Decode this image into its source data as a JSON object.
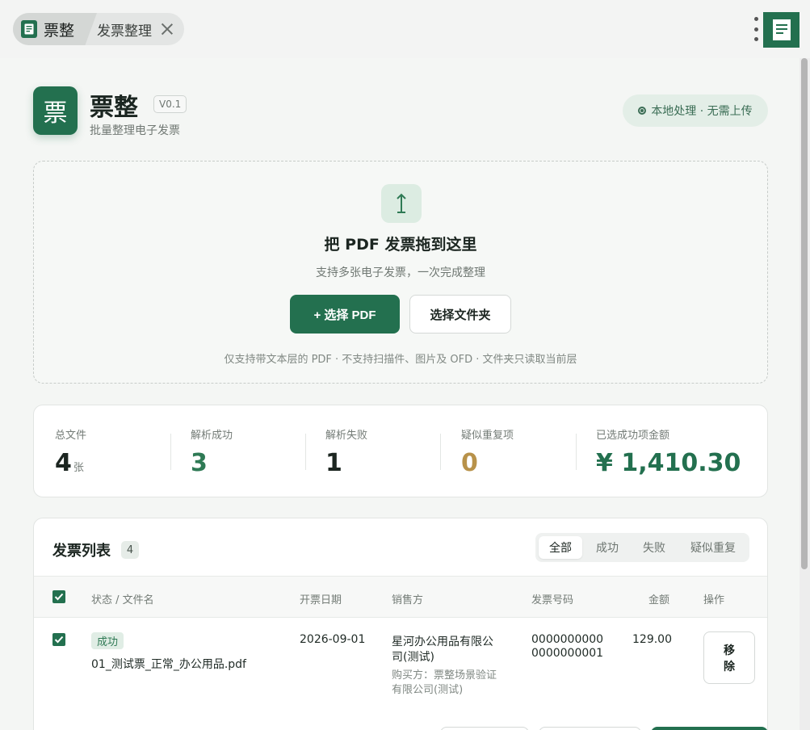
{
  "tabs": [
    {
      "label": "票整",
      "active": true
    },
    {
      "label": "发票整理",
      "active": false
    }
  ],
  "app": {
    "logo_char": "票",
    "name": "票整",
    "version": "V0.1",
    "subtitle": "批量整理电子发票",
    "local_badge": "本地处理 · 无需上传"
  },
  "dropzone": {
    "title": "把 PDF 发票拖到这里",
    "subtitle": "支持多张电子发票，一次完成整理",
    "select_pdf_label": "+ 选择 PDF",
    "select_folder_label": "选择文件夹",
    "note": "仅支持带文本层的 PDF · 不支持扫描件、图片及 OFD · 文件夹只读取当前层"
  },
  "stats": {
    "total": {
      "label": "总文件",
      "value": "4",
      "unit": "张"
    },
    "success": {
      "label": "解析成功",
      "value": "3"
    },
    "failed": {
      "label": "解析失败",
      "value": "1"
    },
    "duplicate": {
      "label": "疑似重复项",
      "value": "0"
    },
    "amount": {
      "label": "已选成功项金额",
      "value": "¥ 1,410.30"
    }
  },
  "list": {
    "title": "发票列表",
    "count": "4",
    "filters": [
      "全部",
      "成功",
      "失败",
      "疑似重复"
    ],
    "active_filter": "全部",
    "columns": {
      "status_file": "状态 / 文件名",
      "date": "开票日期",
      "seller": "销售方",
      "number": "发票号码",
      "amount": "金额",
      "action": "操作"
    },
    "rows": [
      {
        "checked": true,
        "status": "成功",
        "filename": "01_测试票_正常_办公用品.pdf",
        "date": "2026-09-01",
        "seller_line1": "星河办公用品有限公",
        "seller_line2": "司(测试)",
        "buyer_line1": "购买方：票整场景验证",
        "buyer_line2": "有限公司(测试)",
        "number_line1": "0000000000",
        "number_line2": "0000000001",
        "amount": "129.00",
        "remove_line1": "移",
        "remove_line2": "除"
      }
    ]
  },
  "colors": {
    "brand": "#23704f",
    "success_value": "#2f7a55",
    "duplicate_value": "#b8924a",
    "background": "#f4f6f4"
  }
}
